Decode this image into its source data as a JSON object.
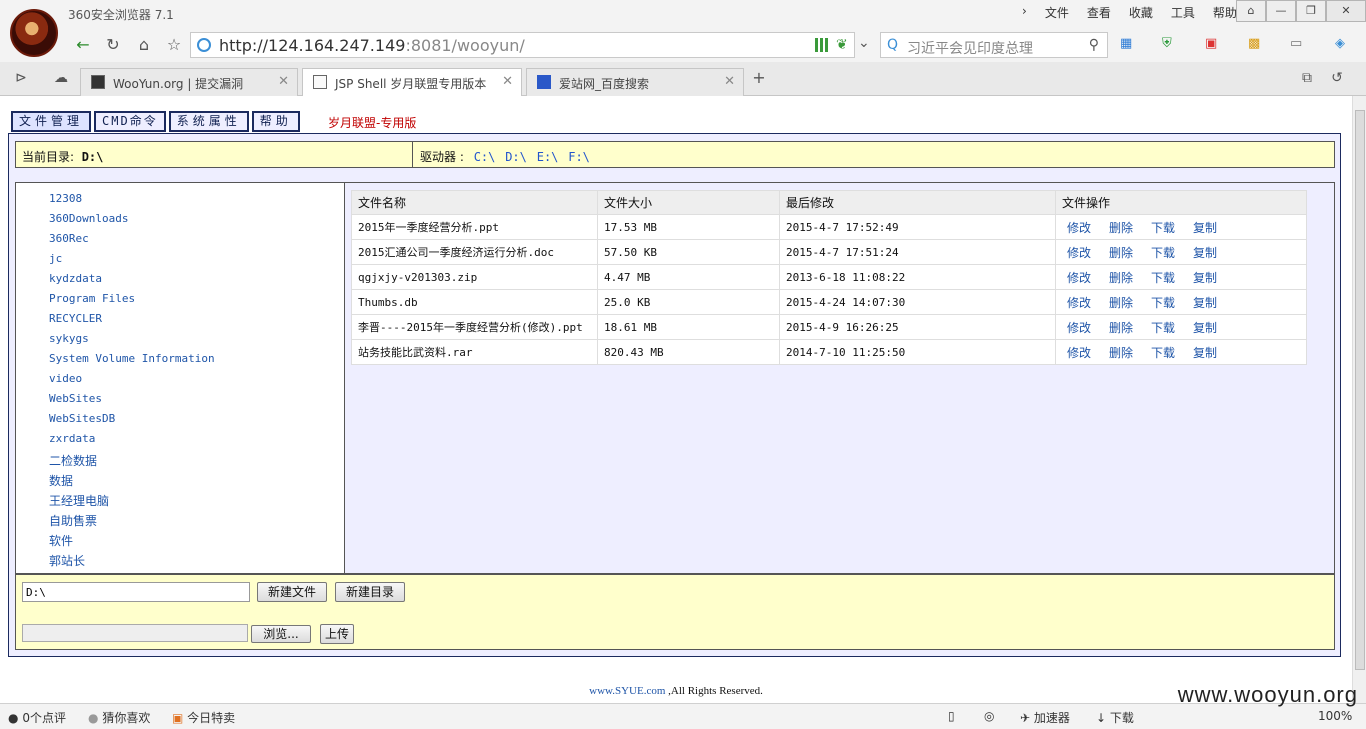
{
  "browser": {
    "app_title": "360安全浏览器 7.1",
    "menu": [
      "文件",
      "查看",
      "收藏",
      "工具",
      "帮助"
    ],
    "window_buttons": [
      "⌂",
      "—",
      "❐",
      "✕"
    ],
    "url_host": "http://124.164.247.149",
    "url_rest": ":8081/wooyun/",
    "search_placeholder": "习近平会见印度总理",
    "tabs": [
      {
        "label": "WooYun.org | 提交漏洞"
      },
      {
        "label": "JSP Shell 岁月联盟专用版本"
      },
      {
        "label": "爱站网_百度搜索"
      }
    ],
    "new_tab": "+"
  },
  "shell": {
    "nav": [
      "文件管理",
      "CMD命令",
      "系统属性",
      "帮助"
    ],
    "brand": "岁月联盟-专用版",
    "current_dir_label": "当前目录:",
    "current_dir": "D:\\",
    "drives_label": "驱动器 :",
    "drives": [
      "C:\\",
      "D:\\",
      "E:\\",
      "F:\\"
    ],
    "dirs": [
      "12308",
      "360Downloads",
      "360Rec",
      "jc",
      "kydzdata",
      "Program Files",
      "RECYCLER",
      "sykygs",
      "System Volume Information",
      "video",
      "WebSites",
      "WebSitesDB",
      "zxrdata",
      "二检数据",
      "数据",
      "王经理电脑",
      "自助售票",
      "软件",
      "郭站长"
    ],
    "table": {
      "headers": [
        "文件名称",
        "文件大小",
        "最后修改",
        "文件操作"
      ],
      "rows": [
        {
          "name": "2015年一季度经营分析.ppt",
          "size": "17.53 MB",
          "modified": "2015-4-7 17:52:49"
        },
        {
          "name": "2015汇通公司一季度经济运行分析.doc",
          "size": "57.50 KB",
          "modified": "2015-4-7 17:51:24"
        },
        {
          "name": "qgjxjy-v201303.zip",
          "size": "4.47 MB",
          "modified": "2013-6-18 11:08:22"
        },
        {
          "name": "Thumbs.db",
          "size": "25.0 KB",
          "modified": "2015-4-24 14:07:30"
        },
        {
          "name": "李晋----2015年一季度经营分析(修改).ppt",
          "size": "18.61 MB",
          "modified": "2015-4-9 16:26:25"
        },
        {
          "name": "站务技能比武资料.rar",
          "size": "820.43 MB",
          "modified": "2014-7-10 11:25:50"
        }
      ],
      "ops": [
        "修改",
        "删除",
        "下载",
        "复制"
      ]
    },
    "path_input_value": "D:\\",
    "new_file_button": "新建文件",
    "new_dir_button": "新建目录",
    "browse_button": "浏览...",
    "upload_button": "上传",
    "footer_site": "www.SYUE.com",
    "footer_text": " ,All Rights Reserved."
  },
  "status": {
    "comments": "0个点评",
    "guess": "猜你喜欢",
    "deal": "今日特卖",
    "accelerator": "加速器",
    "download": "下载",
    "zoom": "100%",
    "watermark": "www.wooyun.org"
  }
}
